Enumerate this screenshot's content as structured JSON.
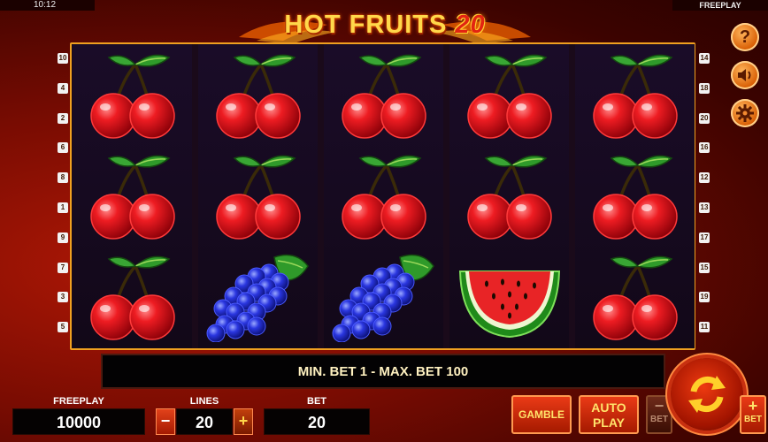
{
  "status_bar": {
    "time": "10:12",
    "mode": "FREEPLAY"
  },
  "logo": {
    "text": "HOT FRUITS",
    "number": "20"
  },
  "left_lines": [
    "10",
    "4",
    "2",
    "6",
    "8",
    "1",
    "9",
    "7",
    "3",
    "5"
  ],
  "right_lines": [
    "14",
    "18",
    "20",
    "16",
    "12",
    "13",
    "17",
    "15",
    "19",
    "11"
  ],
  "reels": [
    [
      "cherry",
      "cherry",
      "cherry"
    ],
    [
      "cherry",
      "cherry",
      "grapes"
    ],
    [
      "cherry",
      "cherry",
      "grapes"
    ],
    [
      "cherry",
      "cherry",
      "watermelon"
    ],
    [
      "cherry",
      "cherry",
      "cherry"
    ]
  ],
  "side_buttons": [
    "help-icon",
    "sound-icon",
    "settings-icon"
  ],
  "message": "MIN. BET 1 - MAX. BET 100",
  "balance": {
    "label": "FREEPLAY",
    "value": "10000"
  },
  "lines": {
    "label": "LINES",
    "value": "20",
    "minus": "−",
    "plus": "+"
  },
  "bet": {
    "label": "BET",
    "value": "20"
  },
  "buttons": {
    "gamble": "GAMBLE",
    "autoplay_1": "AUTO",
    "autoplay_2": "PLAY",
    "bet_minus": "BET",
    "bet_plus": "BET"
  },
  "colors": {
    "frame": "#f0a020",
    "accent": "#ffd84a",
    "cherry": "#e0141e",
    "grapes": "#2a32d8"
  }
}
